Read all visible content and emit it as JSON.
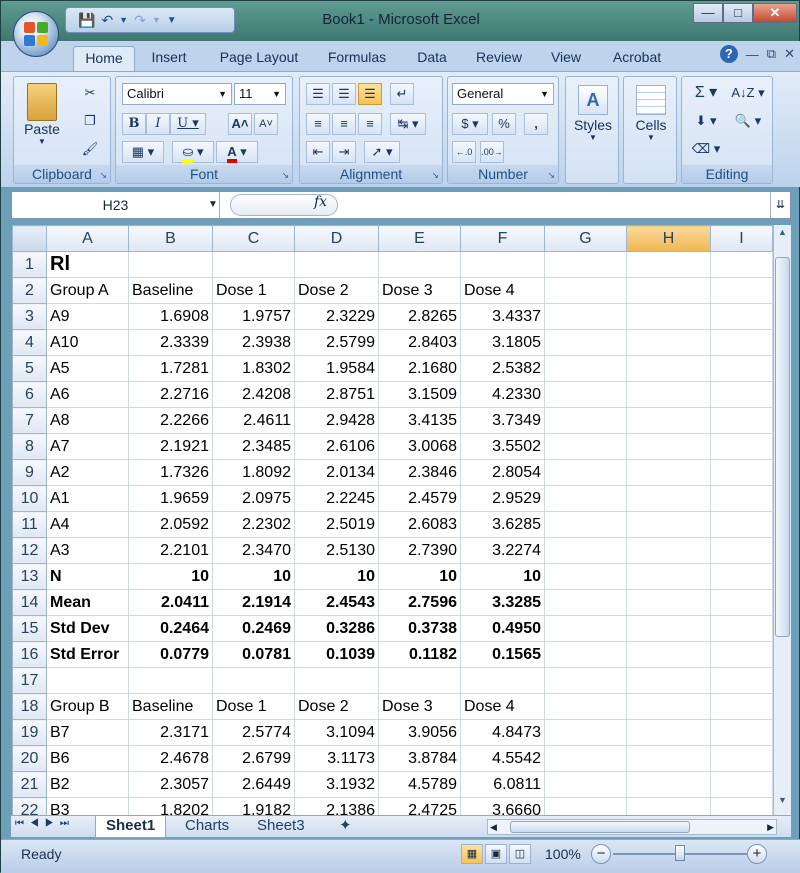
{
  "window": {
    "title": "Book1 - Microsoft Excel"
  },
  "ribbon_tabs": [
    "Home",
    "Insert",
    "Page Layout",
    "Formulas",
    "Data",
    "Review",
    "View",
    "Acrobat"
  ],
  "ribbon": {
    "clipboard": {
      "label": "Clipboard",
      "paste": "Paste"
    },
    "font": {
      "label": "Font",
      "name": "Calibri",
      "size": "11"
    },
    "alignment": {
      "label": "Alignment"
    },
    "number": {
      "label": "Number",
      "format": "General"
    },
    "styles": {
      "label": "Styles"
    },
    "cells": {
      "label": "Cells"
    },
    "editing": {
      "label": "Editing"
    }
  },
  "formula_bar": {
    "name_box": "H23",
    "fx": "fx",
    "value": ""
  },
  "columns": [
    "A",
    "B",
    "C",
    "D",
    "E",
    "F",
    "G",
    "H",
    "I"
  ],
  "selected_column": "H",
  "rows": [
    {
      "n": "1",
      "cells": [
        "Rl",
        "",
        "",
        "",
        "",
        ""
      ],
      "style": "title"
    },
    {
      "n": "2",
      "cells": [
        "Group A",
        "Baseline",
        "Dose 1",
        "Dose 2",
        "Dose 3",
        "Dose 4"
      ],
      "style": "header"
    },
    {
      "n": "3",
      "cells": [
        "A9",
        "1.6908",
        "1.9757",
        "2.3229",
        "2.8265",
        "3.4337"
      ]
    },
    {
      "n": "4",
      "cells": [
        "A10",
        "2.3339",
        "2.3938",
        "2.5799",
        "2.8403",
        "3.1805"
      ]
    },
    {
      "n": "5",
      "cells": [
        "A5",
        "1.7281",
        "1.8302",
        "1.9584",
        "2.1680",
        "2.5382"
      ]
    },
    {
      "n": "6",
      "cells": [
        "A6",
        "2.2716",
        "2.4208",
        "2.8751",
        "3.1509",
        "4.2330"
      ]
    },
    {
      "n": "7",
      "cells": [
        "A8",
        "2.2266",
        "2.4611",
        "2.9428",
        "3.4135",
        "3.7349"
      ]
    },
    {
      "n": "8",
      "cells": [
        "A7",
        "2.1921",
        "2.3485",
        "2.6106",
        "3.0068",
        "3.5502"
      ]
    },
    {
      "n": "9",
      "cells": [
        "A2",
        "1.7326",
        "1.8092",
        "2.0134",
        "2.3846",
        "2.8054"
      ]
    },
    {
      "n": "10",
      "cells": [
        "A1",
        "1.9659",
        "2.0975",
        "2.2245",
        "2.4579",
        "2.9529"
      ]
    },
    {
      "n": "11",
      "cells": [
        "A4",
        "2.0592",
        "2.2302",
        "2.5019",
        "2.6083",
        "3.6285"
      ]
    },
    {
      "n": "12",
      "cells": [
        "A3",
        "2.2101",
        "2.3470",
        "2.5130",
        "2.7390",
        "3.2274"
      ]
    },
    {
      "n": "13",
      "cells": [
        "N",
        "10",
        "10",
        "10",
        "10",
        "10"
      ],
      "style": "bold"
    },
    {
      "n": "14",
      "cells": [
        "Mean",
        "2.0411",
        "2.1914",
        "2.4543",
        "2.7596",
        "3.3285"
      ],
      "style": "bold"
    },
    {
      "n": "15",
      "cells": [
        "Std Dev",
        "0.2464",
        "0.2469",
        "0.3286",
        "0.3738",
        "0.4950"
      ],
      "style": "bold"
    },
    {
      "n": "16",
      "cells": [
        "Std Error",
        "0.0779",
        "0.0781",
        "0.1039",
        "0.1182",
        "0.1565"
      ],
      "style": "bold"
    },
    {
      "n": "17",
      "cells": [
        "",
        "",
        "",
        "",
        "",
        ""
      ]
    },
    {
      "n": "18",
      "cells": [
        "Group B",
        "Baseline",
        "Dose 1",
        "Dose 2",
        "Dose 3",
        "Dose 4"
      ],
      "style": "header"
    },
    {
      "n": "19",
      "cells": [
        "B7",
        "2.3171",
        "2.5774",
        "3.1094",
        "3.9056",
        "4.8473"
      ]
    },
    {
      "n": "20",
      "cells": [
        "B6",
        "2.4678",
        "2.6799",
        "3.1173",
        "3.8784",
        "4.5542"
      ]
    },
    {
      "n": "21",
      "cells": [
        "B2",
        "2.3057",
        "2.6449",
        "3.1932",
        "4.5789",
        "6.0811"
      ]
    },
    {
      "n": "22",
      "cells": [
        "B3",
        "1.8202",
        "1.9182",
        "2.1386",
        "2.4725",
        "3.6660"
      ]
    }
  ],
  "sheet_tabs": [
    "Sheet1",
    "Charts",
    "Sheet3"
  ],
  "active_sheet": "Sheet1",
  "status": {
    "mode": "Ready",
    "zoom": "100%",
    "zoom_fraction": 0.5
  }
}
